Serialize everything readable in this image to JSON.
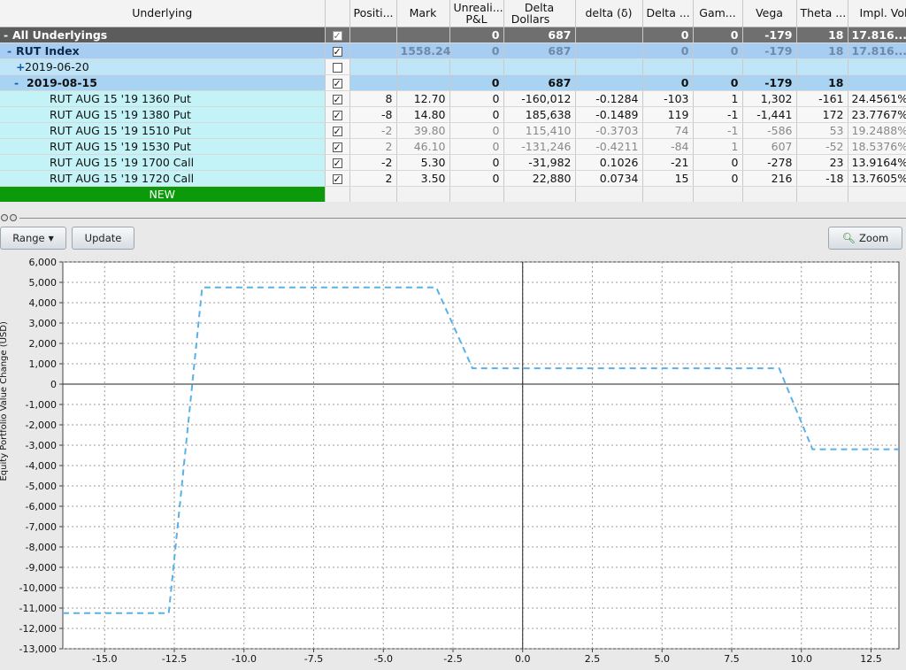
{
  "headers": {
    "underlying": "Underlying",
    "position": "Positi...",
    "mark": "Mark",
    "unreal_1": "Unreali...",
    "unreal_2": "P&L",
    "delta_dollars_1": "Delta",
    "delta_dollars_2": "Dollars",
    "delta": "delta (δ)",
    "delta_more": "Delta ...",
    "gamma": "Gam...",
    "vega": "Vega",
    "theta": "Theta ...",
    "impl_vol": "Impl. Vol."
  },
  "rows": {
    "all": {
      "label": "All Underlyings",
      "unreal": "0",
      "delta_dollars": "687",
      "delta_more": "0",
      "gamma": "0",
      "vega": "-179",
      "theta": "18",
      "impl_vol": "17.816..."
    },
    "rut": {
      "label": "RUT Index",
      "mark": "1558.24",
      "unreal": "0",
      "delta_dollars": "687",
      "delta_more": "0",
      "gamma": "0",
      "vega": "-179",
      "theta": "18",
      "impl_vol": "17.816..."
    },
    "date1": {
      "label": "2019-06-20"
    },
    "date2": {
      "label": "2019-08-15",
      "unreal": "0",
      "delta_dollars": "687",
      "delta_more": "0",
      "gamma": "0",
      "vega": "-179",
      "theta": "18"
    },
    "legs": [
      {
        "label": "RUT AUG 15 '19 1360 Put",
        "position": "8",
        "mark": "12.70",
        "unreal": "0",
        "delta_dollars": "-160,012",
        "delta": "-0.1284",
        "delta_more": "-103",
        "gamma": "1",
        "vega": "1,302",
        "theta": "-161",
        "impl_vol": "24.4561%"
      },
      {
        "label": "RUT AUG 15 '19 1380 Put",
        "position": "-8",
        "mark": "14.80",
        "unreal": "0",
        "delta_dollars": "185,638",
        "delta": "-0.1489",
        "delta_more": "119",
        "gamma": "-1",
        "vega": "-1,441",
        "theta": "172",
        "impl_vol": "23.7767%"
      },
      {
        "label": "RUT AUG 15 '19 1510 Put",
        "position": "-2",
        "mark": "39.80",
        "unreal": "0",
        "delta_dollars": "115,410",
        "delta": "-0.3703",
        "delta_more": "74",
        "gamma": "-1",
        "vega": "-586",
        "theta": "53",
        "impl_vol": "19.2488%"
      },
      {
        "label": "RUT AUG 15 '19 1530 Put",
        "position": "2",
        "mark": "46.10",
        "unreal": "0",
        "delta_dollars": "-131,246",
        "delta": "-0.4211",
        "delta_more": "-84",
        "gamma": "1",
        "vega": "607",
        "theta": "-52",
        "impl_vol": "18.5376%"
      },
      {
        "label": "RUT AUG 15 '19 1700 Call",
        "position": "-2",
        "mark": "5.30",
        "unreal": "0",
        "delta_dollars": "-31,982",
        "delta": "0.1026",
        "delta_more": "-21",
        "gamma": "0",
        "vega": "-278",
        "theta": "23",
        "impl_vol": "13.9164%"
      },
      {
        "label": "RUT AUG 15 '19 1720 Call",
        "position": "2",
        "mark": "3.50",
        "unreal": "0",
        "delta_dollars": "22,880",
        "delta": "0.0734",
        "delta_more": "15",
        "gamma": "0",
        "vega": "216",
        "theta": "-18",
        "impl_vol": "13.7605%"
      }
    ],
    "new": {
      "label": "NEW"
    }
  },
  "toolbar": {
    "range_label": "Range",
    "update_label": "Update",
    "zoom_label": "Zoom"
  },
  "colors": {
    "line": "#5ab0e8",
    "grid": "#9a9a9a",
    "new_row": "#0a9a0a"
  },
  "chart_data": {
    "type": "line",
    "ylabel": "Equity Portfolio Value Change (USD)",
    "xlim": [
      -16.5,
      13.5
    ],
    "ylim": [
      -13000,
      6000
    ],
    "x_ticks": [
      -15.0,
      -12.5,
      -10.0,
      -7.5,
      -5.0,
      -2.5,
      0.0,
      2.5,
      5.0,
      7.5,
      10.0,
      12.5
    ],
    "y_ticks": [
      6000,
      5000,
      4000,
      3000,
      2000,
      1000,
      0,
      -1000,
      -2000,
      -3000,
      -4000,
      -5000,
      -6000,
      -7000,
      -8000,
      -9000,
      -10000,
      -11000,
      -12000,
      -13000
    ],
    "x_tick_labels": [
      "-15.0",
      "-12.5",
      "-10.0",
      "-7.5",
      "-5.0",
      "-2.5",
      "0.0",
      "2.5",
      "5.0",
      "7.5",
      "10.0",
      "12.5"
    ],
    "y_tick_labels": [
      "6,000",
      "5,000",
      "4,000",
      "3,000",
      "2,000",
      "1,000",
      "0",
      "-1,000",
      "-2,000",
      "-3,000",
      "-4,000",
      "-5,000",
      "-6,000",
      "-7,000",
      "-8,000",
      "-9,000",
      "-10,000",
      "-11,000",
      "-12,000",
      "-13,000"
    ],
    "grid": true,
    "series": [
      {
        "x": [
          -16.5,
          -12.7,
          -11.5,
          -3.1,
          -1.8,
          9.2,
          10.4,
          13.5
        ],
        "y": [
          -11250,
          -11250,
          4750,
          4750,
          780,
          780,
          -3200,
          -3200
        ]
      }
    ]
  }
}
